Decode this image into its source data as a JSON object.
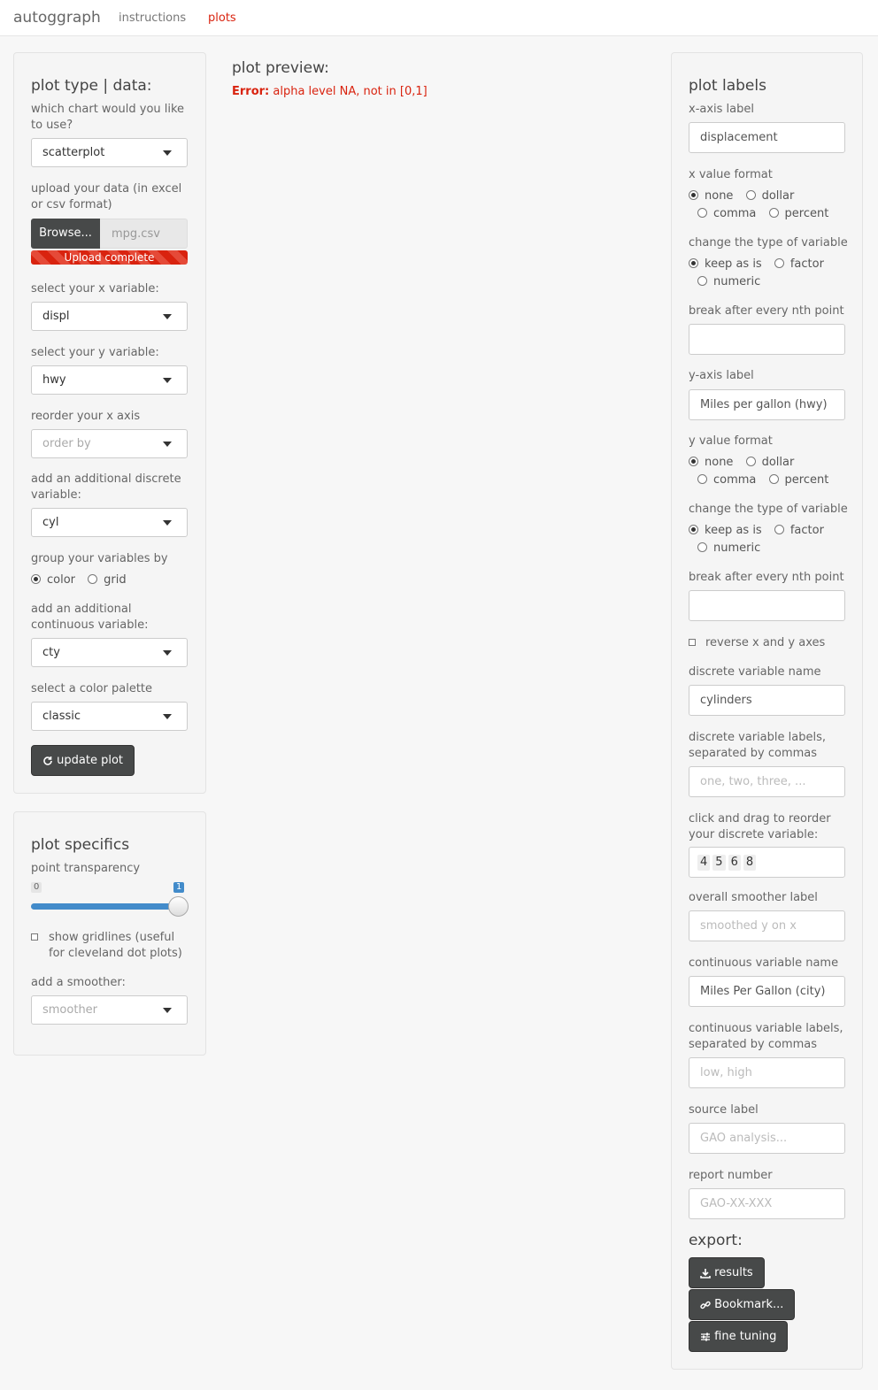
{
  "nav": {
    "brand": "autoggraph",
    "links": [
      "instructions",
      "plots"
    ],
    "active": "plots"
  },
  "left_panel": {
    "title": "plot type | data:",
    "chart_label": "which chart would you like to use?",
    "chart_value": "scatterplot",
    "upload_label": "upload your data (in excel or csv format)",
    "browse_label": "Browse...",
    "file_name": "mpg.csv",
    "upload_status": "Upload complete",
    "x_label": "select your x variable:",
    "x_value": "displ",
    "y_label": "select your y variable:",
    "y_value": "hwy",
    "reorder_label": "reorder your x axis",
    "reorder_placeholder": "order by",
    "discrete_label": "add an additional discrete variable:",
    "discrete_value": "cyl",
    "group_label": "group your variables by",
    "group_options": [
      "color",
      "grid"
    ],
    "group_selected": "color",
    "continuous_label": "add an additional continuous variable:",
    "continuous_value": "cty",
    "palette_label": "select a color palette",
    "palette_value": "classic",
    "update_button": "update plot"
  },
  "specifics_panel": {
    "title": "plot specifics",
    "transparency_label": "point transparency",
    "slider_min": "0",
    "slider_max": "1",
    "slider_value": 1,
    "gridlines_label": "show gridlines (useful for cleveland dot plots)",
    "gridlines_checked": false,
    "smoother_label": "add a smoother:",
    "smoother_placeholder": "smoother"
  },
  "preview": {
    "title": "plot preview:",
    "error_prefix": "Error:",
    "error_message": "alpha level NA, not in [0,1]"
  },
  "labels_panel": {
    "title": "plot labels",
    "x_axis_label": "x-axis label",
    "x_axis_value": "displacement",
    "x_format_label": "x value format",
    "format_options": [
      "none",
      "dollar",
      "comma",
      "percent"
    ],
    "x_format_selected": "none",
    "x_type_label": "change the type of variable",
    "type_options": [
      "keep as is",
      "factor",
      "numeric"
    ],
    "x_type_selected": "keep as is",
    "x_break_label": "break after every nth point",
    "x_break_value": "",
    "y_axis_label": "y-axis label",
    "y_axis_value": "Miles per gallon (hwy)",
    "y_format_label": "y value format",
    "y_format_selected": "none",
    "y_type_label": "change the type of variable",
    "y_type_selected": "keep as is",
    "y_break_label": "break after every nth point",
    "y_break_value": "",
    "reverse_label": "reverse x and y axes",
    "reverse_checked": false,
    "discrete_name_label": "discrete variable name",
    "discrete_name_value": "cylinders",
    "discrete_labels_label": "discrete variable labels, separated by commas",
    "discrete_labels_placeholder": "one, two, three, ...",
    "reorder_label": "click and drag to reorder your discrete variable:",
    "reorder_items": [
      "4",
      "5",
      "6",
      "8"
    ],
    "smoother_label": "overall smoother label",
    "smoother_placeholder": "smoothed y on x",
    "continuous_name_label": "continuous variable name",
    "continuous_name_value": "Miles Per Gallon (city)",
    "continuous_labels_label": "continuous variable labels, separated by commas",
    "continuous_labels_placeholder": "low, high",
    "source_label": "source label",
    "source_placeholder": "GAO analysis...",
    "report_label": "report number",
    "report_placeholder": "GAO-XX-XXX",
    "export_title": "export:",
    "results_button": "results",
    "bookmark_button": "Bookmark...",
    "fine_tuning_button": "fine tuning"
  },
  "colors": {
    "accent": "#d9230f",
    "dark_button": "#474949",
    "slider_fill": "#428bca"
  }
}
